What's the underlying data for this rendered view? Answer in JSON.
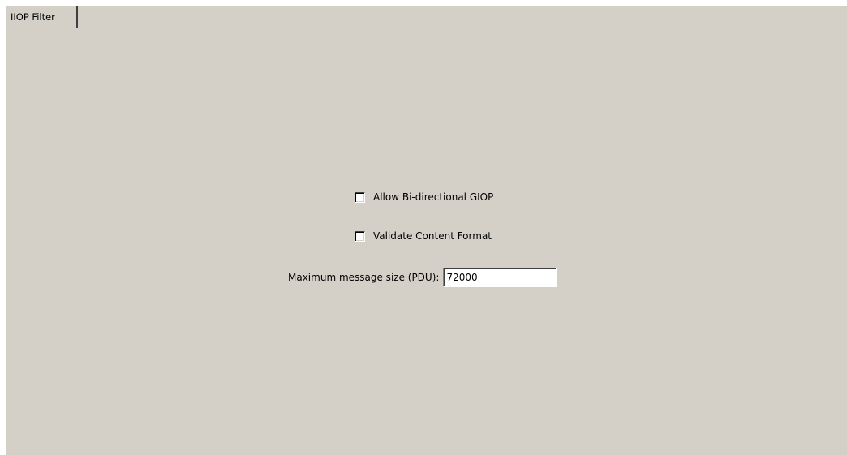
{
  "tabs": [
    {
      "label": "IIOP Filter",
      "active": true
    }
  ],
  "options": {
    "allow_bidirectional": {
      "label": "Allow Bi-directional GIOP",
      "checked": false
    },
    "validate_content": {
      "label": "Validate Content Format",
      "checked": false
    }
  },
  "max_message_size": {
    "label": "Maximum message size (PDU):",
    "value": "72000"
  },
  "colors": {
    "panel_background": "#d4d0c8",
    "page_background": "#ffffff"
  }
}
